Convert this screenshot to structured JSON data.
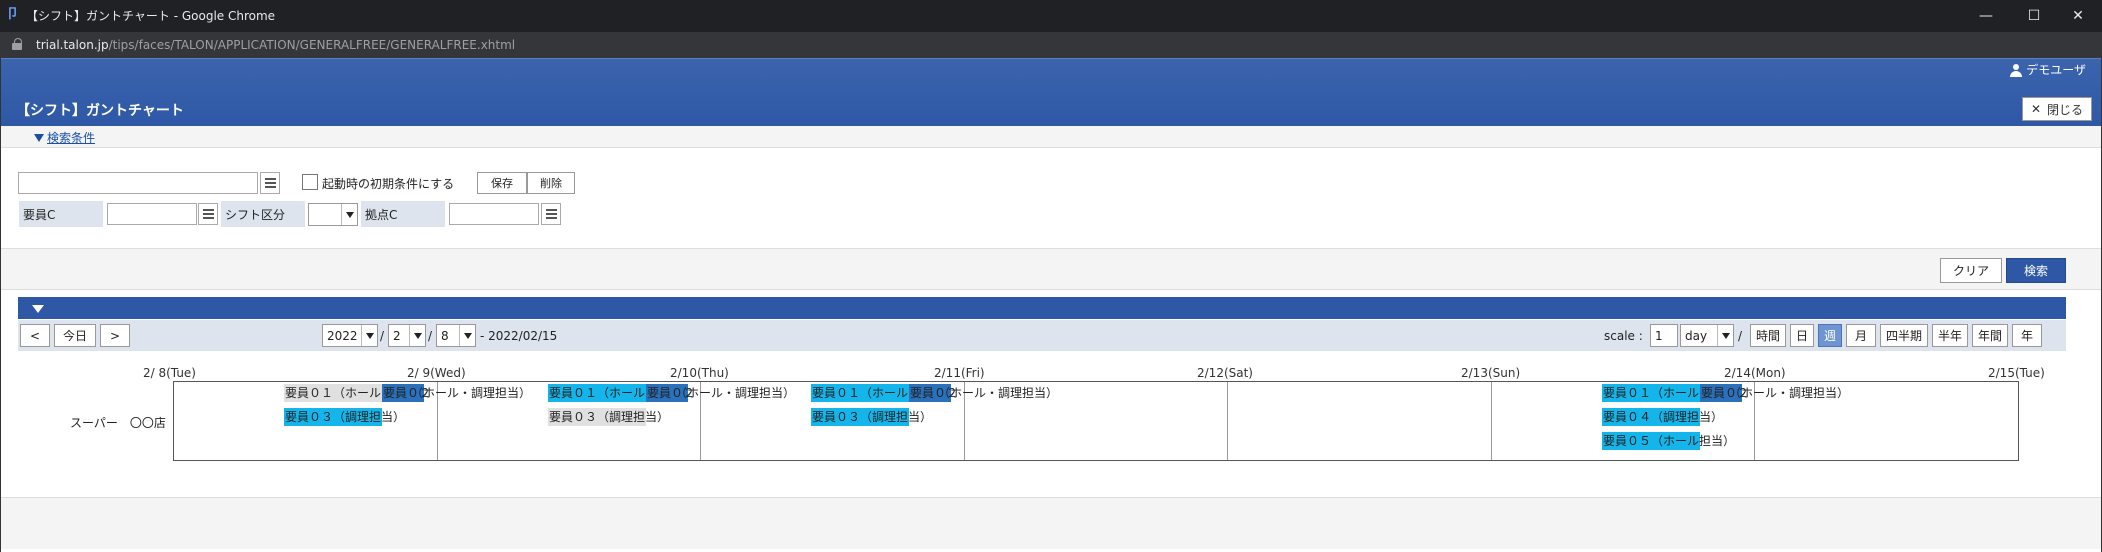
{
  "window": {
    "title": "【シフト】ガントチャート - Google Chrome",
    "minimize": "—",
    "maximize": "☐",
    "close": "✕"
  },
  "address": {
    "host": "trial.talon.jp",
    "path": "/tips/faces/TALON/APPLICATION/GENERALFREE/GENERALFREE.xhtml"
  },
  "header": {
    "user": "デモユーザ",
    "page_title": "【シフト】ガントチャート",
    "close_label": "閉じる"
  },
  "search": {
    "toggle_label": "検索条件",
    "free_text_value": "",
    "default_checkbox_label": "起動時の初期条件にする",
    "save_label": "保存",
    "delete_label": "削除",
    "staff_label": "要員C",
    "staff_value": "",
    "shift_label": "シフト区分",
    "shift_value": "",
    "base_label": "拠点C",
    "base_value": "",
    "clear_label": "クリア",
    "search_label": "検索"
  },
  "toolbar": {
    "prev": "<",
    "today": "今日",
    "next": ">",
    "year": "2022",
    "month": "2",
    "day": "8",
    "end_date": "- 2022/02/15",
    "scale_label": "scale :",
    "scale_value": "1",
    "scale_unit": "day",
    "slash": "/",
    "sep1": "/",
    "sep2": "/",
    "views": [
      "時間",
      "日",
      "週",
      "月",
      "四半期",
      "半年",
      "年間",
      "年"
    ],
    "active_view": "週"
  },
  "gantt": {
    "dates": [
      "2/ 8(Tue)",
      "2/ 9(Wed)",
      "2/10(Thu)",
      "2/11(Fri)",
      "2/12(Sat)",
      "2/13(Sun)",
      "2/14(Mon)",
      "2/15(Tue)"
    ],
    "row_label": "スーパー　〇〇店",
    "bars": [
      {
        "day": 0,
        "lane": 0,
        "color": "gray",
        "text": "要員０１（ホール"
      },
      {
        "day": 0,
        "lane": 0,
        "color": "blue",
        "text": "要員０２",
        "offset": 1
      },
      {
        "day": 0,
        "lane": 0,
        "color": "none",
        "text": "（ホール・調理担当）",
        "offset": 2
      },
      {
        "day": 0,
        "lane": 1,
        "color": "cyan",
        "text": "要員０３（調理担当）"
      },
      {
        "day": 1,
        "lane": 0,
        "color": "cyan",
        "text": "要員０１（ホール"
      },
      {
        "day": 1,
        "lane": 0,
        "color": "blue",
        "text": "要員０２",
        "offset": 1
      },
      {
        "day": 1,
        "lane": 0,
        "color": "none",
        "text": "（ホール・調理担当）",
        "offset": 2
      },
      {
        "day": 1,
        "lane": 1,
        "color": "gray",
        "text": "要員０３（調理担当）"
      },
      {
        "day": 2,
        "lane": 0,
        "color": "cyan",
        "text": "要員０１（ホール"
      },
      {
        "day": 2,
        "lane": 0,
        "color": "blue",
        "text": "要員０２",
        "offset": 1
      },
      {
        "day": 2,
        "lane": 0,
        "color": "none",
        "text": "（ホール・調理担当）",
        "offset": 2
      },
      {
        "day": 2,
        "lane": 1,
        "color": "cyan",
        "text": "要員０３（調理担当）"
      },
      {
        "day": 5,
        "lane": 0,
        "color": "cyan",
        "text": "要員０１（ホール"
      },
      {
        "day": 5,
        "lane": 0,
        "color": "blue",
        "text": "要員０２",
        "offset": 1
      },
      {
        "day": 5,
        "lane": 0,
        "color": "none",
        "text": "（ホール・調理担当）",
        "offset": 2
      },
      {
        "day": 5,
        "lane": 1,
        "color": "cyan",
        "text": "要員０４（調理担当）"
      },
      {
        "day": 5,
        "lane": 2,
        "color": "cyan",
        "text": "要員０５（ホール担当）"
      }
    ]
  },
  "colors": {
    "header_blue": "#2e58a6",
    "active_view": "#6f94d2",
    "bar_cyan": "#13b5ea",
    "bar_blue": "#2a70ba",
    "bar_gray": "#e0e0e0"
  }
}
